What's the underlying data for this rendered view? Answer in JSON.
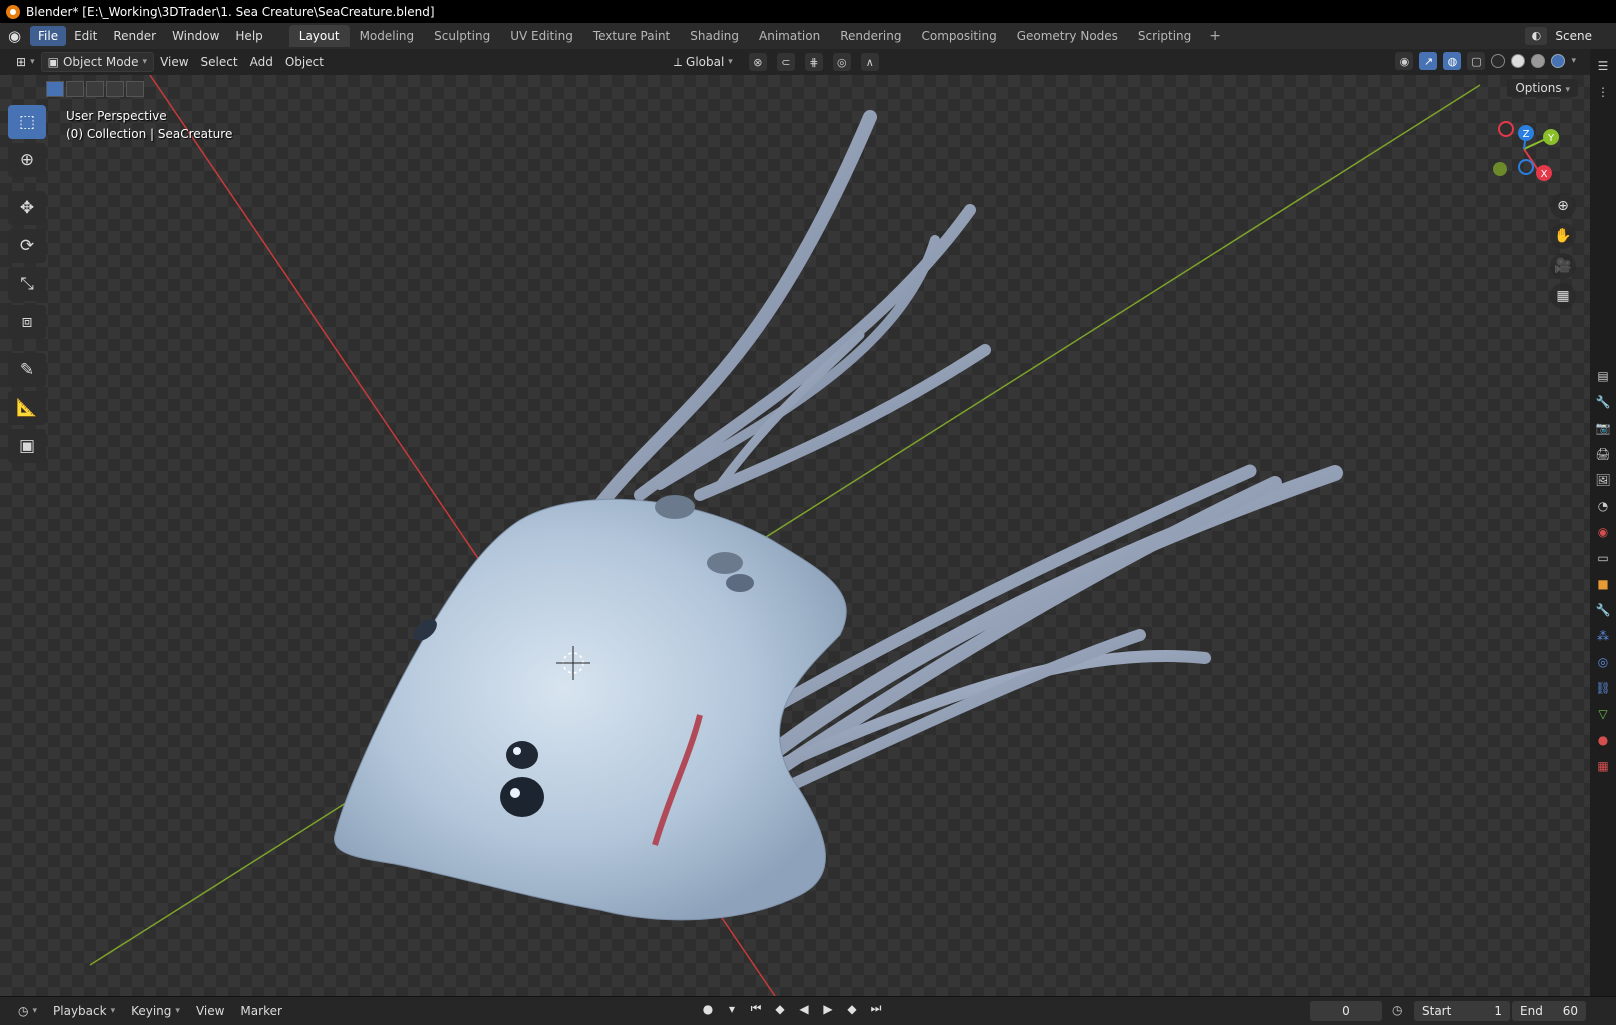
{
  "window": {
    "title": "Blender* [E:\\_Working\\3DTrader\\1. Sea Creature\\SeaCreature.blend]"
  },
  "menu": {
    "items": [
      "File",
      "Edit",
      "Render",
      "Window",
      "Help"
    ]
  },
  "workspaces": [
    "Layout",
    "Modeling",
    "Sculpting",
    "UV Editing",
    "Texture Paint",
    "Shading",
    "Animation",
    "Rendering",
    "Compositing",
    "Geometry Nodes",
    "Scripting"
  ],
  "scene": {
    "label": "Scene"
  },
  "viewport_header": {
    "mode": "Object Mode",
    "menus": [
      "View",
      "Select",
      "Add",
      "Object"
    ],
    "transform_orientation": "Global",
    "options_label": "Options"
  },
  "viewport": {
    "perspective": "User Perspective",
    "collection": "(0) Collection | SeaCreature"
  },
  "gizmo": {
    "axes": [
      "X",
      "Y",
      "Z"
    ],
    "colors": {
      "x": "#e5394a",
      "y": "#8bbf2a",
      "z": "#2b7fe0"
    }
  },
  "timeline": {
    "menus": [
      "Playback",
      "Keying",
      "View",
      "Marker"
    ],
    "current_frame": "0",
    "start_label": "Start",
    "start_value": "1",
    "end_label": "End",
    "end_value": "60"
  },
  "colors": {
    "accent": "#4772b3",
    "x_axis": "#c83a3a",
    "y_axis": "#7ea32a"
  }
}
